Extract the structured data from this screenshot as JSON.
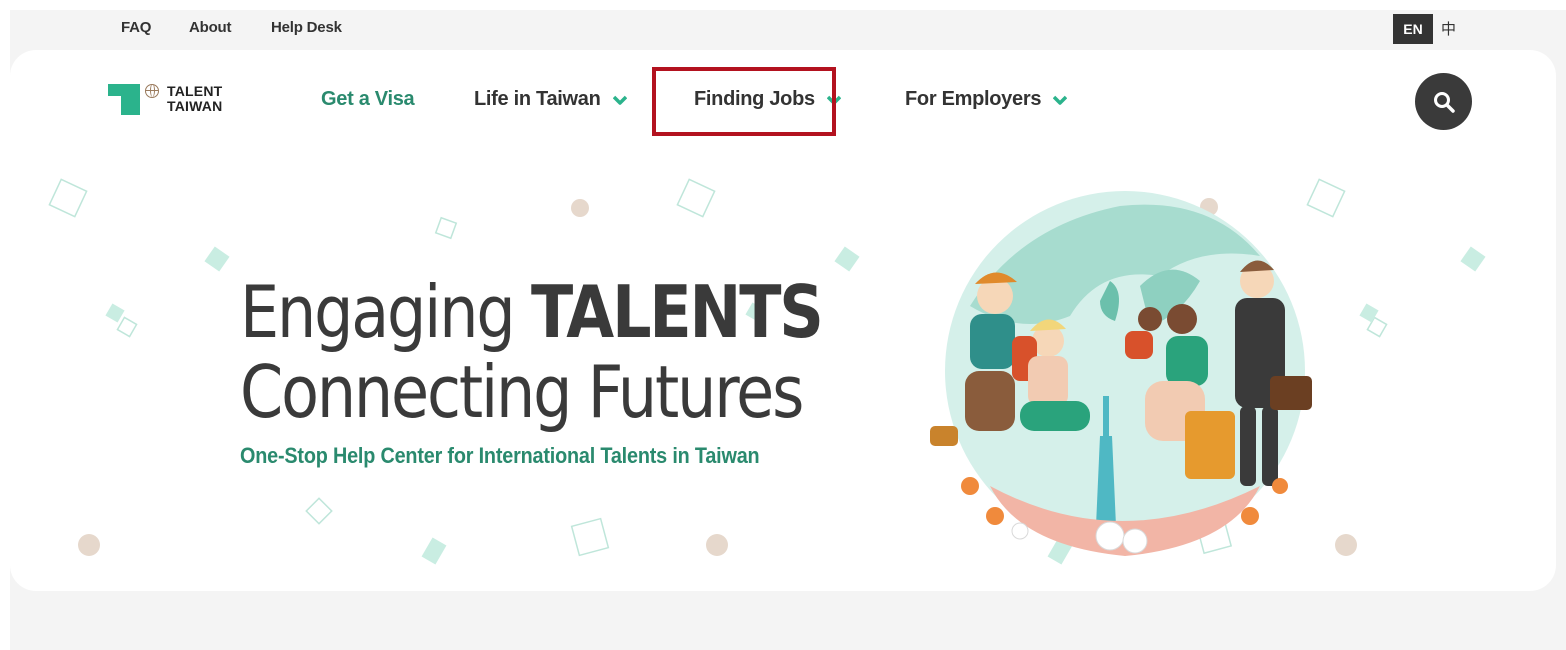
{
  "utility_nav": {
    "items": [
      "FAQ",
      "About",
      "Help Desk"
    ]
  },
  "language": {
    "current": "EN",
    "alternate": "中"
  },
  "header": {
    "logo_line1": "TALENT",
    "logo_line2": "TAIWAN",
    "nav": [
      {
        "label": "Get a Visa",
        "has_dropdown": false,
        "active": true
      },
      {
        "label": "Life in Taiwan",
        "has_dropdown": true
      },
      {
        "label": "Finding Jobs",
        "has_dropdown": true,
        "highlighted": true
      },
      {
        "label": "For Employers",
        "has_dropdown": true
      }
    ],
    "search_icon": "search-icon"
  },
  "hero": {
    "line1_regular": "Engaging ",
    "line1_bold": "TALENTS",
    "line2": "Connecting Futures",
    "tagline": "One-Stop Help Center for International Talents in Taiwan"
  },
  "colors": {
    "brand_green": "#2a8a6e",
    "logo_green": "#2bb38c",
    "highlight_red": "#b3121f",
    "dark": "#333333",
    "background_gray": "#f4f4f4"
  }
}
